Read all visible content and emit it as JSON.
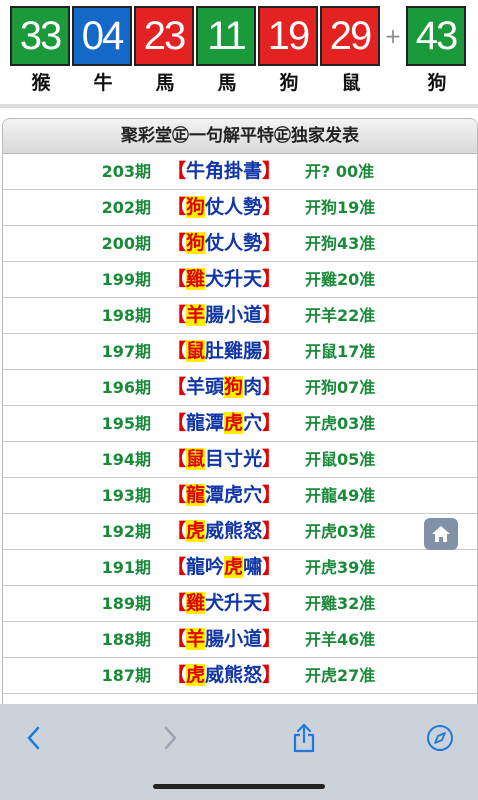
{
  "results": {
    "balls": [
      {
        "number": "33",
        "color": "#1a9a3a",
        "zodiac": "猴"
      },
      {
        "number": "04",
        "color": "#1469c8",
        "zodiac": "牛"
      },
      {
        "number": "23",
        "color": "#e32222",
        "zodiac": "馬"
      },
      {
        "number": "11",
        "color": "#1a9a3a",
        "zodiac": "馬"
      },
      {
        "number": "19",
        "color": "#e32222",
        "zodiac": "狗"
      },
      {
        "number": "29",
        "color": "#e32222",
        "zodiac": "鼠"
      }
    ],
    "plus_sign": "+",
    "special": {
      "number": "43",
      "color": "#1a9a3a",
      "zodiac": "狗"
    }
  },
  "panel": {
    "title": "聚彩堂㊣一句解平特㊣独家发表",
    "rows": [
      {
        "period": "203期",
        "open": "【",
        "phrase": [
          "牛",
          "角",
          "掛",
          "書"
        ],
        "hl": -1,
        "close": "】",
        "result": "开? 00准"
      },
      {
        "period": "202期",
        "open": "【",
        "phrase": [
          "狗",
          "仗",
          "人",
          "勢"
        ],
        "hl": 0,
        "close": "】",
        "result": "开狗19准"
      },
      {
        "period": "200期",
        "open": "【",
        "phrase": [
          "狗",
          "仗",
          "人",
          "勢"
        ],
        "hl": 0,
        "close": "】",
        "result": "开狗43准"
      },
      {
        "period": "199期",
        "open": "【",
        "phrase": [
          "雞",
          "犬",
          "升",
          "天"
        ],
        "hl": 0,
        "close": "】",
        "result": "开雞20准"
      },
      {
        "period": "198期",
        "open": "【",
        "phrase": [
          "羊",
          "腸",
          "小",
          "道"
        ],
        "hl": 0,
        "close": "】",
        "result": "开羊22准"
      },
      {
        "period": "197期",
        "open": "【",
        "phrase": [
          "鼠",
          "肚",
          "雞",
          "腸"
        ],
        "hl": 0,
        "close": "】",
        "result": "开鼠17准"
      },
      {
        "period": "196期",
        "open": "【",
        "phrase": [
          "羊",
          "頭",
          "狗",
          "肉"
        ],
        "hl": 2,
        "close": "】",
        "result": "开狗07准"
      },
      {
        "period": "195期",
        "open": "【",
        "phrase": [
          "龍",
          "潭",
          "虎",
          "穴"
        ],
        "hl": 2,
        "close": "】",
        "result": "开虎03准"
      },
      {
        "period": "194期",
        "open": "【",
        "phrase": [
          "鼠",
          "目",
          "寸",
          "光"
        ],
        "hl": 0,
        "close": "】",
        "result": "开鼠05准"
      },
      {
        "period": "193期",
        "open": "【",
        "phrase": [
          "龍",
          "潭",
          "虎",
          "穴"
        ],
        "hl": 0,
        "close": "】",
        "result": "开龍49准"
      },
      {
        "period": "192期",
        "open": "【",
        "phrase": [
          "虎",
          "威",
          "熊",
          "怒"
        ],
        "hl": 0,
        "close": "】",
        "result": "开虎03准"
      },
      {
        "period": "191期",
        "open": "【",
        "phrase": [
          "龍",
          "吟",
          "虎",
          "嘯"
        ],
        "hl": 2,
        "close": "】",
        "result": "开虎39准"
      },
      {
        "period": "189期",
        "open": "【",
        "phrase": [
          "雞",
          "犬",
          "升",
          "天"
        ],
        "hl": 0,
        "close": "】",
        "result": "开雞32准"
      },
      {
        "period": "188期",
        "open": "【",
        "phrase": [
          "羊",
          "腸",
          "小",
          "道"
        ],
        "hl": 0,
        "close": "】",
        "result": "开羊46准"
      },
      {
        "period": "187期",
        "open": "【",
        "phrase": [
          "虎",
          "威",
          "熊",
          "怒"
        ],
        "hl": 0,
        "close": "】",
        "result": "开虎27准"
      }
    ]
  },
  "toolbar": {
    "back_icon": "chevron-left",
    "forward_icon": "chevron-right",
    "share_icon": "share",
    "compass_icon": "compass",
    "accent": "#1f7ae0"
  }
}
